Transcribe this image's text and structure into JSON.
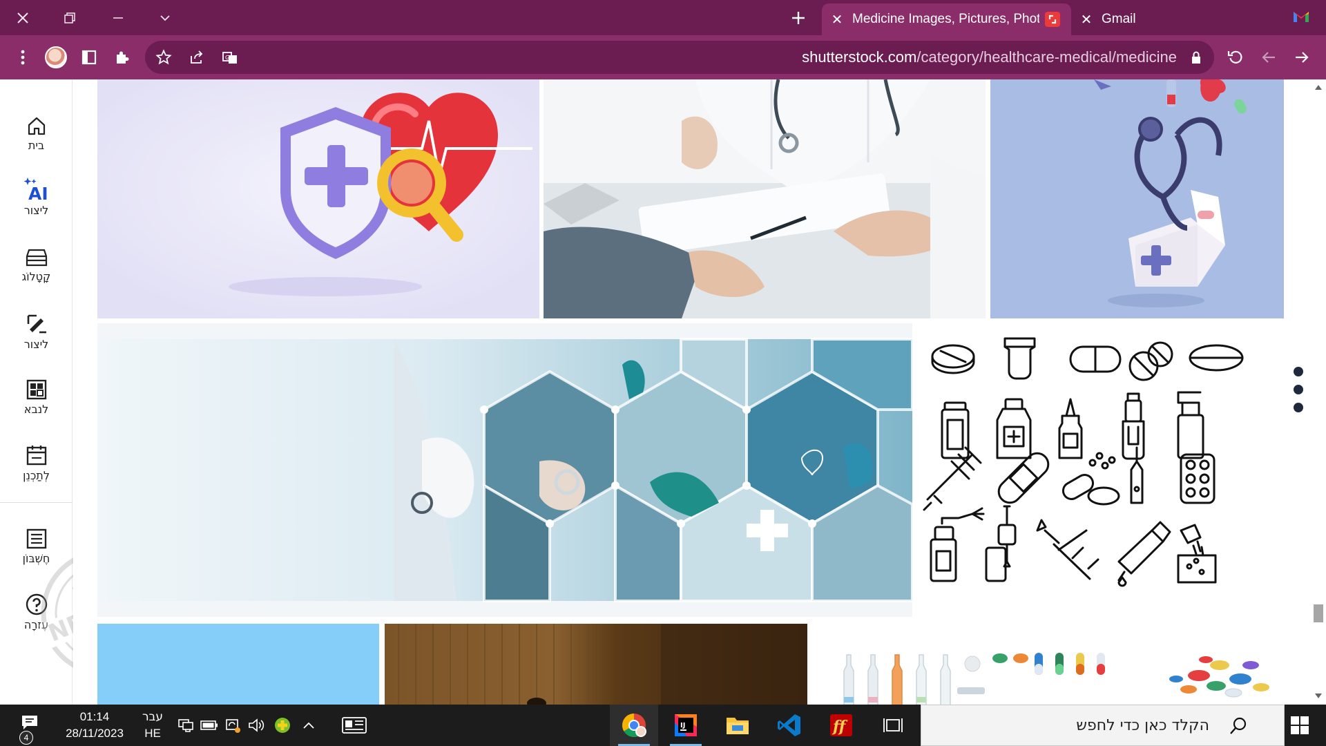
{
  "browser": {
    "tabs": [
      {
        "title": "Medicine Images, Pictures, Photo",
        "active": true
      },
      {
        "title": "Gmail",
        "active": false
      }
    ],
    "url": {
      "domain": "shutterstock.com",
      "path": "/category/healthcare-medical/medicine"
    }
  },
  "sidebar": {
    "items": [
      {
        "label": "בית",
        "icon": "home-icon"
      },
      {
        "label": "ליצור",
        "icon": "ai-sparkle-icon",
        "badge": "AI"
      },
      {
        "label": "קָטָלוֹג",
        "icon": "catalog-icon"
      },
      {
        "label": "ליצור",
        "icon": "edit-icon"
      },
      {
        "label": "לנבא",
        "icon": "dashboard-icon"
      },
      {
        "label": "לְתַכְנֵן",
        "icon": "calendar-icon"
      },
      {
        "label": "חֶשְׁבּוֹן",
        "icon": "list-icon"
      },
      {
        "label": "עֶזרָה",
        "icon": "help-icon"
      }
    ],
    "watermark": "NETFREE"
  },
  "gallery": {
    "tiles": [
      {
        "name": "heart-shield-3d-image",
        "color": "#e8e7f7"
      },
      {
        "name": "doctor-consultation-image",
        "color": "#e7ebee"
      },
      {
        "name": "stethoscope-firstaid-image",
        "color": "#a8bde4"
      },
      {
        "name": "medical-hexagon-collage-image",
        "color": "#e3eff4"
      },
      {
        "name": "medicine-icon-set-image",
        "color": "#ffffff"
      },
      {
        "name": "blue-background-image",
        "color": "#87cefa"
      },
      {
        "name": "dark-wood-image",
        "color": "#5b3a1a"
      },
      {
        "name": "pills-ampoules-image",
        "color": "#ffffff"
      }
    ]
  },
  "taskbar": {
    "search_placeholder": "הקלד כאן כדי לחפש",
    "time": "01:14",
    "date": "28/11/2023",
    "lang_top": "עבר",
    "lang_bottom": "HE",
    "notifications": "4",
    "apps": [
      "chrome",
      "intellij",
      "file-explorer",
      "vscode",
      "filezilla",
      "task-view"
    ]
  },
  "colors": {
    "titlebar": "#6b1c51",
    "toolbar": "#8a2d69",
    "taskbar": "#1c1c1c"
  }
}
